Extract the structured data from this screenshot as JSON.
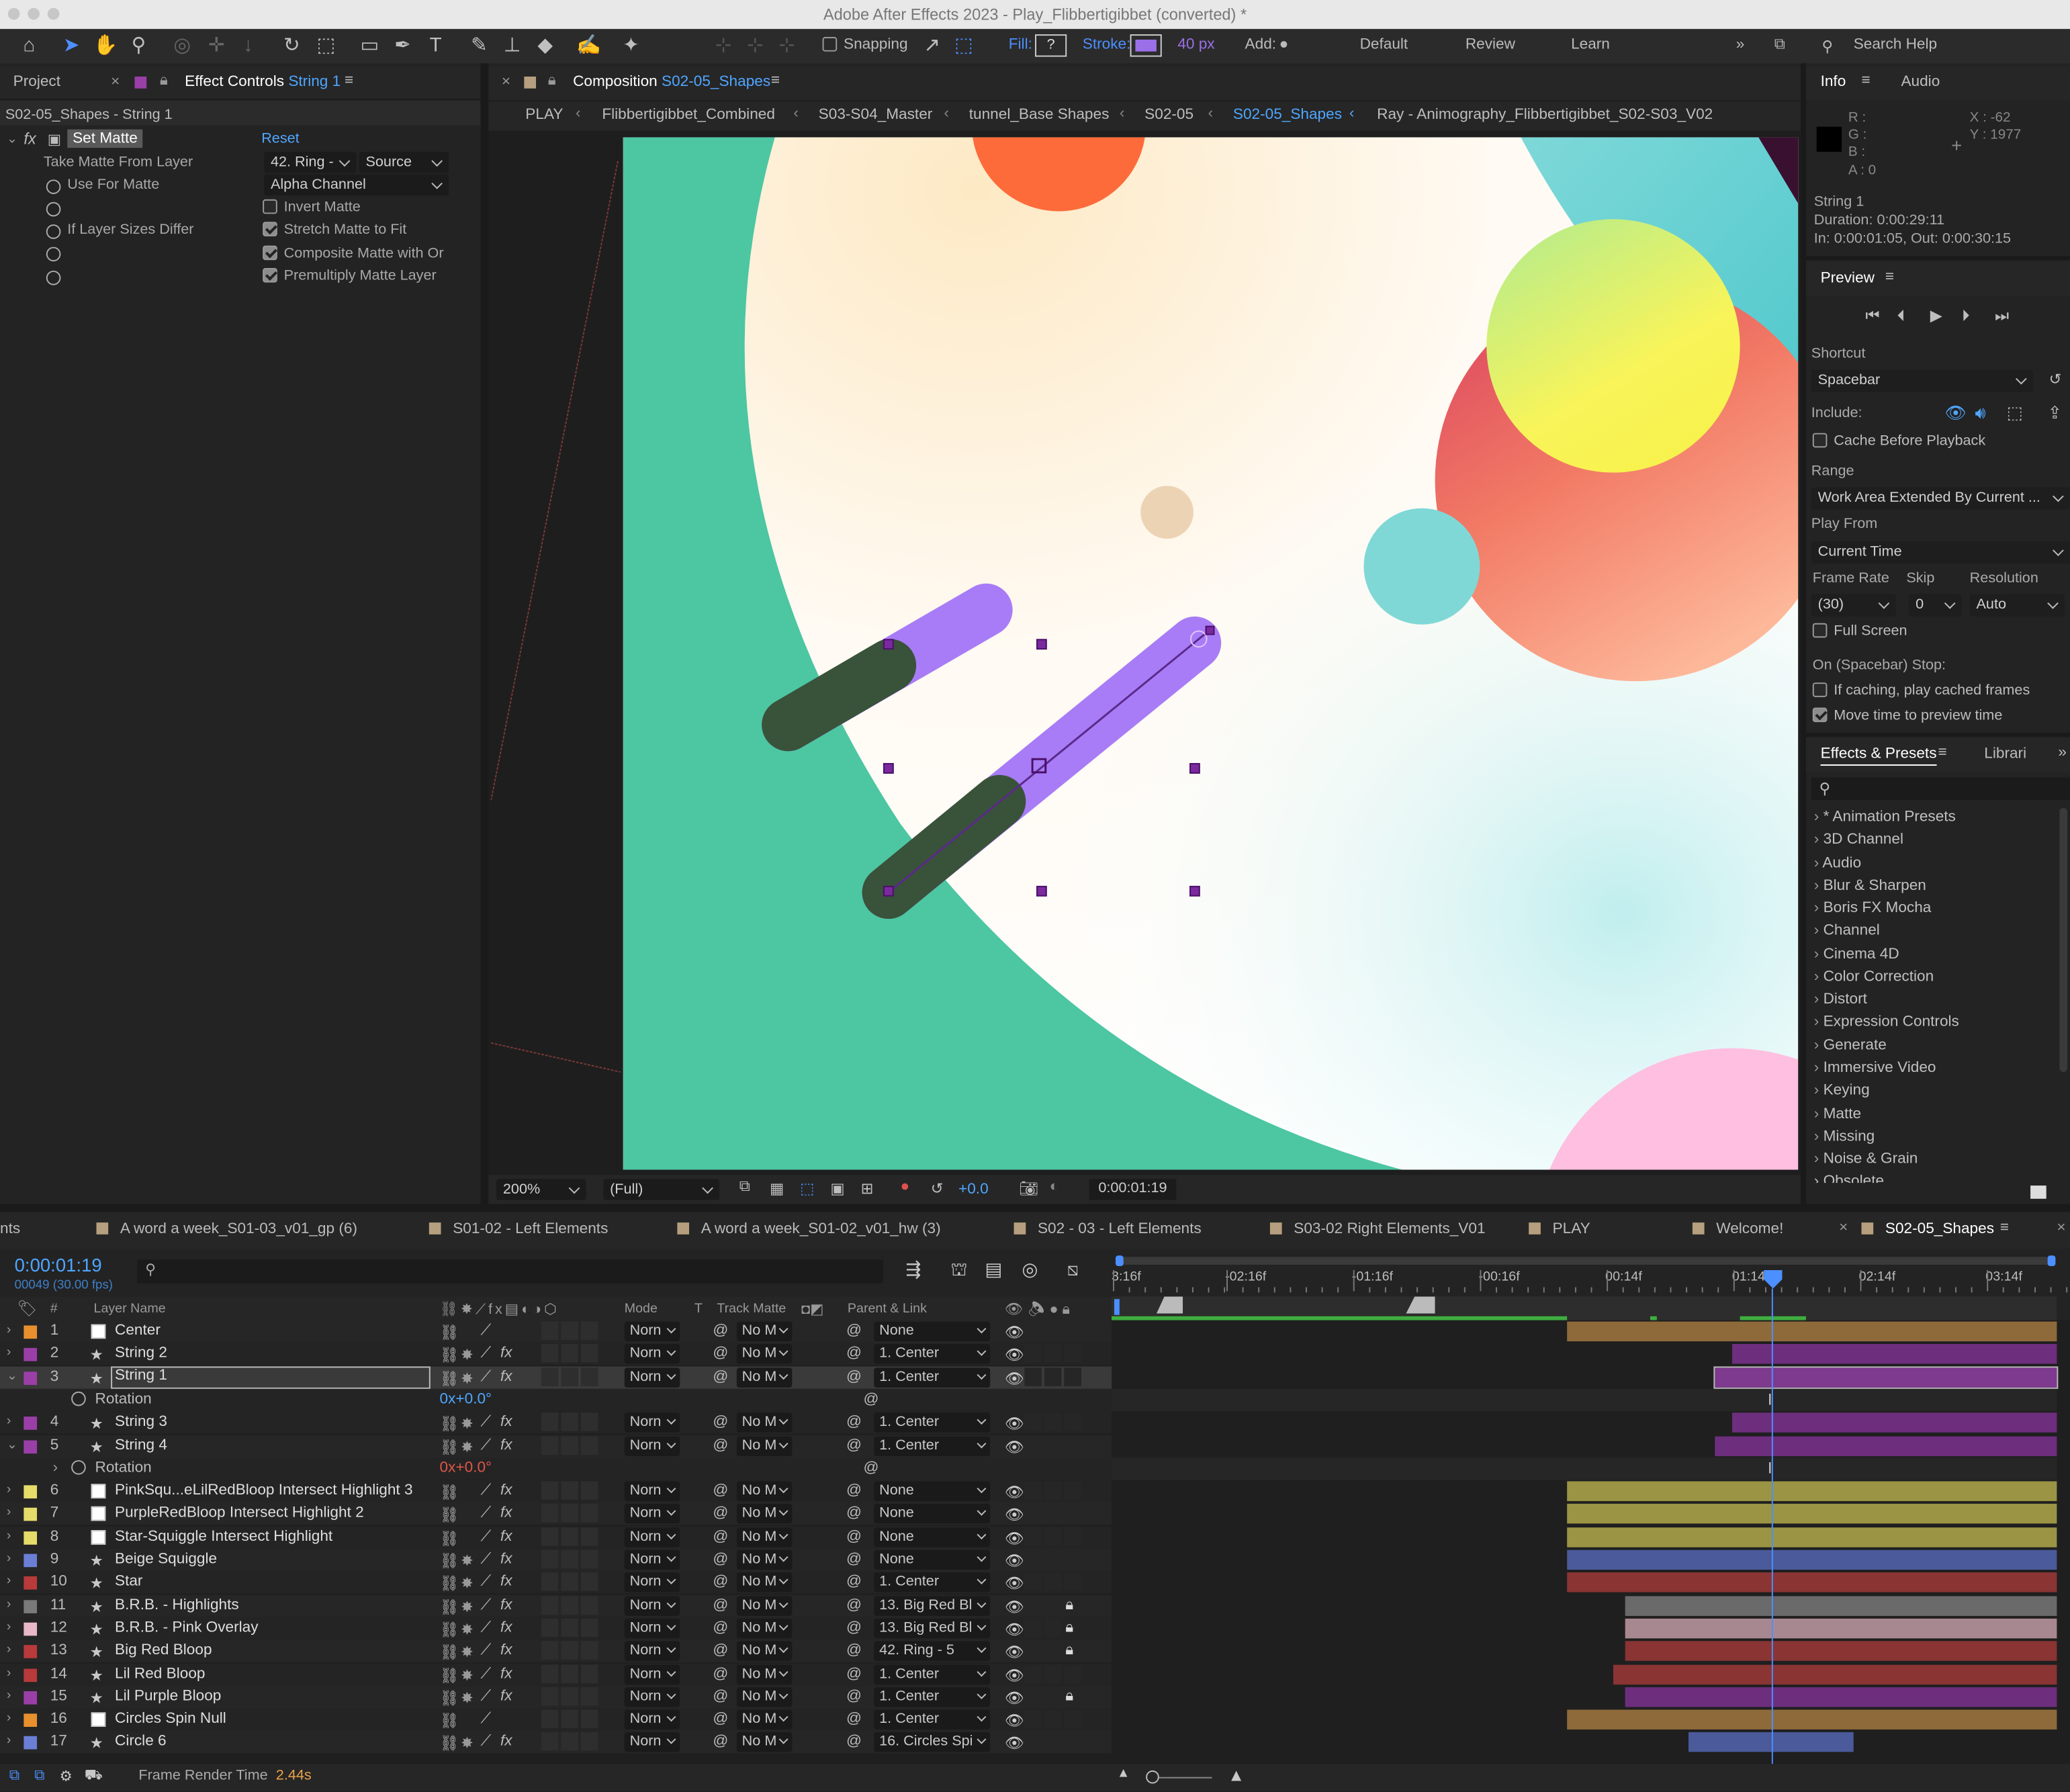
{
  "app": {
    "title": "Adobe After Effects 2023 - Play_Flibbertigibbet (converted) *"
  },
  "toolbar": {
    "snapping": "Snapping",
    "fill": "Fill:",
    "fill_value": "?",
    "stroke": "Stroke:",
    "stroke_px": "40 px",
    "add": "Add:",
    "workspaces": [
      "Default",
      "Review",
      "Learn"
    ],
    "search_help": "Search Help",
    "accent": "#4c8fff"
  },
  "left_panel": {
    "tab_project": "Project",
    "tab_effect_controls": "Effect Controls",
    "effect_controls_layer": "String 1",
    "header": "S02-05_Shapes - String 1",
    "effect_name": "Set Matte",
    "reset": "Reset",
    "take_matte_label": "Take Matte From Layer",
    "take_matte_value": "42. Ring -",
    "take_matte_source": "Source",
    "use_for_matte_label": "Use For Matte",
    "use_for_matte_value": "Alpha Channel",
    "invert_matte": "Invert Matte",
    "if_layer_sizes_label": "If Layer Sizes Differ",
    "stretch_matte": "Stretch Matte to Fit",
    "composite_matte": "Composite Matte with Or",
    "premultiply": "Premultiply Matte Layer"
  },
  "comp_panel": {
    "tab_label": "Composition",
    "comp_name": "S02-05_Shapes",
    "breadcrumbs": [
      "PLAY",
      "Flibbertigibbet_Combined",
      "S03-S04_Master",
      "tunnel_Base Shapes",
      "S02-05",
      "S02-05_Shapes",
      "Ray - Animography_Flibbertigibbet_S02-S03_V02"
    ],
    "zoom": "200%",
    "resolution": "(Full)",
    "exposure": "+0.0",
    "timecode": "0:00:01:19"
  },
  "info_panel": {
    "tab_info": "Info",
    "tab_audio": "Audio",
    "r": "R :",
    "g": "G :",
    "b": "B :",
    "a": "A :  0",
    "x": "X : -62",
    "y": "Y : 1977",
    "layer": "String 1",
    "duration": "Duration: 0:00:29:11",
    "inout": "In: 0:00:01:05, Out: 0:00:30:15"
  },
  "preview_panel": {
    "title": "Preview",
    "shortcut_label": "Shortcut",
    "shortcut_value": "Spacebar",
    "include_label": "Include:",
    "cache_before": "Cache Before Playback",
    "range_label": "Range",
    "range_value": "Work Area Extended By Current ...",
    "play_from_label": "Play From",
    "play_from_value": "Current Time",
    "frame_rate_label": "Frame Rate",
    "skip_label": "Skip",
    "resolution_label": "Resolution",
    "frame_rate_value": "(30)",
    "skip_value": "0",
    "resolution_value": "Auto",
    "full_screen": "Full Screen",
    "on_stop": "On (Spacebar) Stop:",
    "if_caching": "If caching, play cached frames",
    "move_time": "Move time to preview time"
  },
  "effects_panel": {
    "tab_effects": "Effects & Presets",
    "tab_libraries": "Librari",
    "categories": [
      "* Animation Presets",
      "3D Channel",
      "Audio",
      "Blur & Sharpen",
      "Boris FX Mocha",
      "Channel",
      "Cinema 4D",
      "Color Correction",
      "Distort",
      "Expression Controls",
      "Generate",
      "Immersive Video",
      "Keying",
      "Matte",
      "Missing",
      "Noise & Grain"
    ],
    "cutoff": "Obsolete"
  },
  "timeline": {
    "tabs": [
      {
        "label": "nts",
        "color": ""
      },
      {
        "label": "A word a week_S01-03_v01_gp (6)",
        "color": "#b69f7e"
      },
      {
        "label": "S01-02 - Left Elements",
        "color": "#b69f7e"
      },
      {
        "label": "A word a week_S01-02_v01_hw (3)",
        "color": "#b69f7e"
      },
      {
        "label": "S02 - 03 - Left Elements",
        "color": "#b69f7e"
      },
      {
        "label": "S03-02 Right Elements_V01",
        "color": "#b69f7e"
      },
      {
        "label": "PLAY",
        "color": "#b69f7e"
      },
      {
        "label": "Welcome!",
        "color": "#b69f7e"
      },
      {
        "label": "S02-05_Shapes",
        "color": "#b69f7e"
      }
    ],
    "current_time": "0:00:01:19",
    "frame_info": "00049 (30.00 fps)",
    "ruler": [
      "3:16f",
      "-02:16f",
      "-01:16f",
      "-00:16f",
      "00:14f",
      "01:14f",
      "02:14f",
      "03:14f"
    ],
    "col_hash": "#",
    "col_layer_name": "Layer Name",
    "col_mode": "Mode",
    "col_t": "T",
    "col_track_matte": "Track Matte",
    "col_parent": "Parent & Link",
    "rotation_label": "Rotation",
    "rotation_value": "0x+0.0°",
    "mode_value": "Norn",
    "matte_value": "No M",
    "layers": [
      {
        "num": "1",
        "name": "Center",
        "color": "#e8902e",
        "parent": "None",
        "star": false,
        "fx": false,
        "lock": false
      },
      {
        "num": "2",
        "name": "String 2",
        "color": "#9b3fa8",
        "parent": "1. Center",
        "star": true,
        "fx": true,
        "lock": false
      },
      {
        "num": "3",
        "name": "String 1",
        "color": "#9b3fa8",
        "parent": "1. Center",
        "star": true,
        "fx": true,
        "lock": false
      },
      {
        "num": "4",
        "name": "String 3",
        "color": "#9b3fa8",
        "parent": "1. Center",
        "star": true,
        "fx": true,
        "lock": false
      },
      {
        "num": "5",
        "name": "String 4",
        "color": "#9b3fa8",
        "parent": "1. Center",
        "star": true,
        "fx": true,
        "lock": false
      },
      {
        "num": "6",
        "name": "PinkSqu...eLilRedBloop Intersect Highlight 3",
        "color": "#e6dc6a",
        "parent": "None",
        "star": false,
        "fx": true,
        "lock": false
      },
      {
        "num": "7",
        "name": "PurpleRedBloop Intersect Highlight 2",
        "color": "#e6dc6a",
        "parent": "None",
        "star": false,
        "fx": true,
        "lock": false
      },
      {
        "num": "8",
        "name": "Star-Squiggle Intersect Highlight",
        "color": "#e6dc6a",
        "parent": "None",
        "star": false,
        "fx": true,
        "lock": false
      },
      {
        "num": "9",
        "name": "Beige Squiggle",
        "color": "#6b7fd6",
        "parent": "None",
        "star": true,
        "fx": true,
        "lock": false
      },
      {
        "num": "10",
        "name": "Star",
        "color": "#b83a3a",
        "parent": "1. Center",
        "star": true,
        "fx": true,
        "lock": false
      },
      {
        "num": "11",
        "name": "B.R.B. - Highlights",
        "color": "#7a7a7a",
        "parent": "13. Big Red Bl",
        "star": true,
        "fx": true,
        "lock": true
      },
      {
        "num": "12",
        "name": "B.R.B. - Pink Overlay",
        "color": "#e8b8c8",
        "parent": "13. Big Red Bl",
        "star": true,
        "fx": true,
        "lock": true
      },
      {
        "num": "13",
        "name": "Big Red Bloop",
        "color": "#b83a3a",
        "parent": "42. Ring - 5",
        "star": true,
        "fx": true,
        "lock": true
      },
      {
        "num": "14",
        "name": "Lil Red Bloop",
        "color": "#b83a3a",
        "parent": "1. Center",
        "star": true,
        "fx": true,
        "lock": false
      },
      {
        "num": "15",
        "name": "Lil Purple Bloop",
        "color": "#9b3fa8",
        "parent": "1. Center",
        "star": true,
        "fx": true,
        "lock": true
      },
      {
        "num": "16",
        "name": "Circles Spin Null",
        "color": "#e8902e",
        "parent": "1. Center",
        "star": false,
        "fx": false,
        "lock": false
      },
      {
        "num": "17",
        "name": "Circle 6",
        "color": "#6b7fd6",
        "parent": "16. Circles Spi",
        "star": true,
        "fx": true,
        "lock": false
      }
    ],
    "render_label": "Frame Render Time",
    "render_value": "2.44s"
  }
}
